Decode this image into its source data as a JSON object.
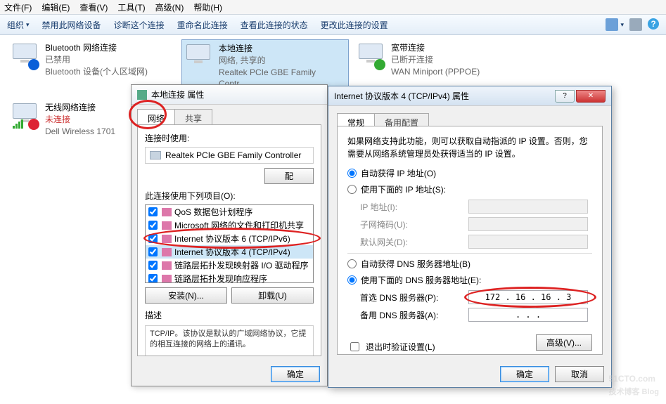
{
  "menubar": [
    "文件(F)",
    "编辑(E)",
    "查看(V)",
    "工具(T)",
    "高级(N)",
    "帮助(H)"
  ],
  "toolbar": {
    "organize": "组织",
    "items": [
      "禁用此网络设备",
      "诊断这个连接",
      "重命名此连接",
      "查看此连接的状态",
      "更改此连接的设置"
    ]
  },
  "connections": [
    {
      "name": "Bluetooth 网络连接",
      "status": "已禁用",
      "device": "Bluetooth 设备(个人区域网)",
      "badge": "bt"
    },
    {
      "name": "本地连接",
      "status": "网络, 共享的",
      "device": "Realtek PCIe GBE Family Contr...",
      "selected": true
    },
    {
      "name": "宽带连接",
      "status": "已断开连接",
      "device": "WAN Miniport (PPPOE)",
      "badge": "ok"
    },
    {
      "name": "无线网络连接",
      "status": "未连接",
      "device": "Dell Wireless 1701",
      "badge": "x",
      "bars": true
    }
  ],
  "dlg1": {
    "title": "本地连接 属性",
    "tabs": [
      "网络",
      "共享"
    ],
    "connect_using_label": "连接时使用:",
    "adapter": "Realtek PCIe GBE Family Controller",
    "configure_btn": "配",
    "items_label": "此连接使用下列项目(O):",
    "protocols": [
      {
        "label": "QoS 数据包计划程序",
        "checked": true
      },
      {
        "label": "Microsoft 网络的文件和打印机共享",
        "checked": true
      },
      {
        "label": "Internet 协议版本 6 (TCP/IPv6)",
        "checked": true
      },
      {
        "label": "Internet 协议版本 4 (TCP/IPv4)",
        "checked": true,
        "sel": true
      },
      {
        "label": "链路层拓扑发现映射器 I/O 驱动程序",
        "checked": true
      },
      {
        "label": "链路层拓扑发现响应程序",
        "checked": true
      }
    ],
    "install_btn": "安装(N)...",
    "uninstall_btn": "卸载(U)",
    "desc_label": "描述",
    "desc_text": "TCP/IP。该协议是默认的广域网络协议，它提的相互连接的网络上的通讯。",
    "ok": "确定"
  },
  "dlg2": {
    "title": "Internet 协议版本 4 (TCP/IPv4) 属性",
    "tabs": [
      "常规",
      "备用配置"
    ],
    "note": "如果网络支持此功能，则可以获取自动指派的 IP 设置。否则，您需要从网络系统管理员处获得适当的 IP 设置。",
    "auto_ip": "自动获得 IP 地址(O)",
    "manual_ip": "使用下面的 IP 地址(S):",
    "ip_label": "IP 地址(I):",
    "subnet_label": "子网掩码(U):",
    "gateway_label": "默认网关(D):",
    "auto_dns": "自动获得 DNS 服务器地址(B)",
    "manual_dns": "使用下面的 DNS 服务器地址(E):",
    "pref_dns_label": "首选 DNS 服务器(P):",
    "alt_dns_label": "备用 DNS 服务器(A):",
    "pref_dns_value": "172 . 16 . 16 . 3",
    "alt_dns_value": " .  .  . ",
    "validate": "退出时验证设置(L)",
    "advanced": "高级(V)...",
    "ok": "确定",
    "cancel": "取消"
  },
  "watermark": {
    "main": "51CTO.com",
    "sub": "技术博客  Blog"
  }
}
